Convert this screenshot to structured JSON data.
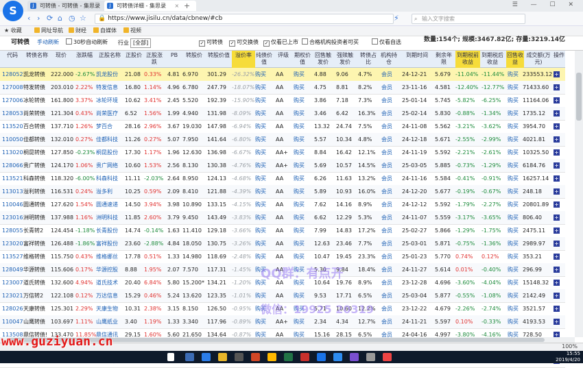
{
  "browser": {
    "tabs": [
      {
        "label": "可转债 - 可转债 - 集思录"
      },
      {
        "label": "可转债详细 - 集思录"
      }
    ],
    "url": "https://www.jisilu.cn/data/cbnew/#cb",
    "search_placeholder": "输入文字搜索",
    "bookmarks": [
      "收藏",
      "网址导航",
      "财经",
      "自媒体",
      "视频"
    ],
    "zoom": "100%"
  },
  "filters": {
    "title": "可转债",
    "manual_refresh": "手动刷新",
    "auto_refresh": "30秒自动刷新",
    "industry_label": "行业",
    "industry_value": "[全部]",
    "check_cb": "可转债",
    "check_exchangeable": "可交换债",
    "check_listed": "仅看已上市",
    "check_qualified": "合格机构投资者可买",
    "check_self": "仅看自选",
    "stats": "数量:154个; 规模:3467.82亿; 存量:3219.14亿"
  },
  "table": {
    "headers": [
      "代码",
      "转债名称",
      "现价",
      "涨跌幅",
      "正股名称",
      "正股价",
      "正股涨跌",
      "PB",
      "转股价",
      "转股价值",
      "溢价率",
      "纯债价值",
      "评级",
      "期权价值",
      "回售触发价",
      "强赎触发价",
      "转债占比",
      "机构持仓",
      "到期时间",
      "剩余年限",
      "到期税前收益",
      "到期税后收益",
      "回售收益",
      "成交额(万元)",
      "操作"
    ],
    "rows": [
      {
        "code": "128052",
        "name": "凯龙转债",
        "price": "222.000",
        "chg": "-2.67%",
        "stock": "凯龙股份",
        "sprice": "21.08",
        "schg": "0.33%",
        "pb": "4.81",
        "cvt": "6.970",
        "cval": "301.29",
        "prem": "-26.32%",
        "bond": "购买",
        "rating": "AA",
        "opt": "购买",
        "put": "4.88",
        "call": "9.06",
        "ratio": "4.7%",
        "inst": "会员",
        "due": "24-12-21",
        "years": "5.679",
        "ytm": "-11.04%",
        "ytm2": "-11.44%",
        "putret": "购买",
        "vol": "233553.12"
      },
      {
        "code": "127008",
        "name": "特发转债",
        "price": "203.010",
        "chg": "2.22%",
        "stock": "特发信息",
        "sprice": "16.80",
        "schg": "1.14%",
        "pb": "4.96",
        "cvt": "6.780",
        "cval": "247.79",
        "prem": "-18.07%",
        "bond": "购买",
        "rating": "AA",
        "opt": "购买",
        "put": "4.75",
        "call": "8.81",
        "ratio": "8.2%",
        "inst": "会员",
        "due": "23-11-16",
        "years": "4.581",
        "ytm": "-12.40%",
        "ytm2": "-12.77%",
        "putret": "购买",
        "vol": "71433.60"
      },
      {
        "code": "127006",
        "name": "冰轮转债",
        "price": "161.800",
        "chg": "3.37%",
        "stock": "冰轮环境",
        "sprice": "10.62",
        "schg": "3.41%",
        "pb": "2.45",
        "cvt": "5.520",
        "cval": "192.39",
        "prem": "-15.90%",
        "bond": "购买",
        "rating": "AA",
        "opt": "购买",
        "put": "3.86",
        "call": "7.18",
        "ratio": "7.3%",
        "inst": "会员",
        "due": "25-01-14",
        "years": "5.745",
        "ytm": "-5.82%",
        "ytm2": "-6.25%",
        "putret": "购买",
        "vol": "11164.06"
      },
      {
        "code": "128053",
        "name": "尚荣转债",
        "price": "121.304",
        "chg": "0.43%",
        "stock": "尚荣医疗",
        "sprice": "6.52",
        "schg": "1.56%",
        "pb": "1.99",
        "cvt": "4.940",
        "cval": "131.98",
        "prem": "-8.09%",
        "bond": "购买",
        "rating": "AA",
        "opt": "购买",
        "put": "3.46",
        "call": "6.42",
        "ratio": "16.3%",
        "inst": "会员",
        "due": "25-02-14",
        "years": "5.830",
        "ytm": "-0.88%",
        "ytm2": "-1.34%",
        "putret": "购买",
        "vol": "1735.12"
      },
      {
        "code": "113520",
        "name": "百合转债",
        "price": "137.710",
        "chg": "1.26%",
        "stock": "梦百合",
        "sprice": "28.16",
        "schg": "2.96%",
        "pb": "3.67",
        "cvt": "19.030",
        "cval": "147.98",
        "prem": "-6.94%",
        "bond": "购买",
        "rating": "AA",
        "opt": "购买",
        "put": "13.32",
        "call": "24.74",
        "ratio": "7.5%",
        "inst": "会员",
        "due": "24-11-08",
        "years": "5.562",
        "ytm": "-3.21%",
        "ytm2": "-3.62%",
        "putret": "购买",
        "vol": "3954.70"
      },
      {
        "code": "110050",
        "name": "佳都转债",
        "price": "132.010",
        "chg": "0.27%",
        "stock": "佳都科技",
        "sprice": "11.26",
        "schg": "0.27%",
        "pb": "5.07",
        "cvt": "7.950",
        "cval": "141.64",
        "prem": "-6.80%",
        "bond": "购买",
        "rating": "AA",
        "opt": "购买",
        "put": "5.57",
        "call": "10.34",
        "ratio": "4.8%",
        "inst": "会员",
        "due": "24-12-18",
        "years": "5.671",
        "ytm": "-2.55%",
        "ytm2": "-2.99%",
        "putret": "购买",
        "vol": "4021.81"
      },
      {
        "code": "113020",
        "name": "桐昆转债",
        "price": "127.850",
        "chg": "-0.23%",
        "stock": "桐昆股份",
        "sprice": "17.30",
        "schg": "1.17%",
        "pb": "1.96",
        "cvt": "12.630",
        "cval": "136.98",
        "prem": "-6.67%",
        "bond": "购买",
        "rating": "AA+",
        "opt": "购买",
        "put": "8.84",
        "call": "16.42",
        "ratio": "12.1%",
        "inst": "会员",
        "due": "24-11-19",
        "years": "5.592",
        "ytm": "-2.21%",
        "ytm2": "-2.61%",
        "putret": "购买",
        "vol": "10325.50"
      },
      {
        "code": "128066",
        "name": "贵广转债",
        "price": "124.170",
        "chg": "1.06%",
        "stock": "贵广网络",
        "sprice": "10.60",
        "schg": "1.53%",
        "pb": "2.56",
        "cvt": "8.130",
        "cval": "130.38",
        "prem": "-4.76%",
        "bond": "购买",
        "rating": "AA+",
        "opt": "购买",
        "put": "5.69",
        "call": "10.57",
        "ratio": "14.5%",
        "inst": "会员",
        "due": "25-03-05",
        "years": "5.885",
        "ytm": "-0.73%",
        "ytm2": "-1.29%",
        "putret": "购买",
        "vol": "6184.76"
      },
      {
        "code": "113521",
        "name": "科森转债",
        "price": "118.320",
        "chg": "-6.00%",
        "stock": "科森科技",
        "sprice": "11.11",
        "schg": "-2.03%",
        "pb": "2.64",
        "cvt": "8.950",
        "cval": "124.13",
        "prem": "-4.68%",
        "bond": "购买",
        "rating": "AA",
        "opt": "购买",
        "put": "6.26",
        "call": "11.63",
        "ratio": "13.2%",
        "inst": "会员",
        "due": "24-11-16",
        "years": "5.584",
        "ytm": "-0.41%",
        "ytm2": "-0.91%",
        "putret": "购买",
        "vol": "16257.14"
      },
      {
        "code": "113013",
        "name": "溢利转债",
        "price": "116.531",
        "chg": "0.24%",
        "stock": "溢多利",
        "sprice": "10.25",
        "schg": "0.59%",
        "pb": "2.09",
        "cvt": "8.410",
        "cval": "121.88",
        "prem": "-4.39%",
        "bond": "购买",
        "rating": "AA",
        "opt": "购买",
        "put": "5.89",
        "call": "10.93",
        "ratio": "16.0%",
        "inst": "会员",
        "due": "24-12-20",
        "years": "5.677",
        "ytm": "-0.19%",
        "ytm2": "-0.67%",
        "putret": "购买",
        "vol": "248.18"
      },
      {
        "code": "110046",
        "name": "圆通转债",
        "price": "127.620",
        "chg": "1.54%",
        "stock": "圆通速递",
        "sprice": "14.50",
        "schg": "3.94%",
        "pb": "3.98",
        "cvt": "10.890",
        "cval": "133.15",
        "prem": "-4.15%",
        "bond": "购买",
        "rating": "AA",
        "opt": "购买",
        "put": "7.62",
        "call": "14.16",
        "ratio": "8.9%",
        "inst": "会员",
        "due": "24-12-12",
        "years": "5.592",
        "ytm": "-1.79%",
        "ytm2": "-2.27%",
        "putret": "购买",
        "vol": "20801.89"
      },
      {
        "code": "123016",
        "name": "洲明转债",
        "price": "137.988",
        "chg": "1.16%",
        "stock": "洲明科技",
        "sprice": "11.85",
        "schg": "2.60%",
        "pb": "3.79",
        "cvt": "9.450",
        "cval": "143.49",
        "prem": "-3.83%",
        "bond": "购买",
        "rating": "AA",
        "opt": "购买",
        "put": "6.62",
        "call": "12.29",
        "ratio": "5.3%",
        "inst": "会员",
        "due": "24-11-07",
        "years": "5.559",
        "ytm": "-3.17%",
        "ytm2": "-3.65%",
        "putret": "购买",
        "vol": "806.40"
      },
      {
        "code": "128055",
        "name": "长青转2",
        "price": "124.454",
        "chg": "-1.18%",
        "stock": "长青股份",
        "sprice": "14.74",
        "schg": "-0.14%",
        "pb": "1.63",
        "cvt": "11.410",
        "cval": "129.18",
        "prem": "-3.66%",
        "bond": "购买",
        "rating": "AA",
        "opt": "购买",
        "put": "7.99",
        "call": "14.83",
        "ratio": "17.2%",
        "inst": "会员",
        "due": "25-02-27",
        "years": "5.866",
        "ytm": "-1.29%",
        "ytm2": "-1.75%",
        "putret": "购买",
        "vol": "2475.11"
      },
      {
        "code": "123020",
        "name": "富祥转债",
        "price": "126.488",
        "chg": "-1.86%",
        "stock": "富祥股份",
        "sprice": "23.60",
        "schg": "-2.88%",
        "pb": "4.84",
        "cvt": "18.050",
        "cval": "130.75",
        "prem": "-3.26%",
        "bond": "购买",
        "rating": "AA",
        "opt": "购买",
        "put": "12.63",
        "call": "23.46",
        "ratio": "7.7%",
        "inst": "会员",
        "due": "25-03-01",
        "years": "5.871",
        "ytm": "-0.75%",
        "ytm2": "-1.36%",
        "putret": "购买",
        "vol": "2989.97"
      },
      {
        "code": "113527",
        "name": "维格转债",
        "price": "115.750",
        "chg": "0.43%",
        "stock": "维格娜丝",
        "sprice": "17.78",
        "schg": "0.51%",
        "pb": "1.33",
        "cvt": "14.980",
        "cval": "118.69",
        "prem": "-2.48%",
        "bond": "购买",
        "rating": "AA",
        "opt": "购买",
        "put": "10.47",
        "call": "19.45",
        "ratio": "23.3%",
        "inst": "会员",
        "due": "25-01-23",
        "years": "5.770",
        "ytm": "0.74%",
        "ytm2": "0.12%",
        "putret": "购买",
        "vol": "353.21"
      },
      {
        "code": "128049",
        "name": "华源转债",
        "price": "115.606",
        "chg": "0.17%",
        "stock": "华源控股",
        "sprice": "8.88",
        "schg": "1.95%",
        "pb": "2.07",
        "cvt": "7.570",
        "cval": "117.31",
        "prem": "-1.45%",
        "bond": "购买",
        "rating": "AA",
        "opt": "购买",
        "put": "5.30",
        "call": "9.84",
        "ratio": "18.4%",
        "inst": "会员",
        "due": "24-11-27",
        "years": "5.614",
        "ytm": "0.01%",
        "ytm2": "-0.40%",
        "putret": "购买",
        "vol": "296.99"
      },
      {
        "code": "123007",
        "name": "道氏转债",
        "price": "132.600",
        "chg": "4.94%",
        "stock": "道氏技术",
        "sprice": "20.40",
        "schg": "6.84%",
        "pb": "5.80",
        "cvt": "15.200*",
        "cval": "134.21",
        "prem": "-1.20%",
        "bond": "购买",
        "rating": "AA",
        "opt": "购买",
        "put": "10.64",
        "call": "19.76",
        "ratio": "8.9%",
        "inst": "会员",
        "due": "23-12-28",
        "years": "4.696",
        "ytm": "-3.60%",
        "ytm2": "-4.04%",
        "putret": "购买",
        "vol": "15148.32"
      },
      {
        "code": "123021",
        "name": "万信转2",
        "price": "122.108",
        "chg": "0.12%",
        "stock": "万达信息",
        "sprice": "15.29",
        "schg": "0.46%",
        "pb": "5.24",
        "cvt": "13.620",
        "cval": "123.35",
        "prem": "-1.01%",
        "bond": "购买",
        "rating": "AA",
        "opt": "购买",
        "put": "9.53",
        "call": "17.71",
        "ratio": "6.5%",
        "inst": "会员",
        "due": "25-03-04",
        "years": "5.877",
        "ytm": "-0.55%",
        "ytm2": "-1.08%",
        "putret": "购买",
        "vol": "2142.49"
      },
      {
        "code": "128026",
        "name": "天康转债",
        "price": "125.301",
        "chg": "2.29%",
        "stock": "天康生物",
        "sprice": "10.31",
        "schg": "2.38%",
        "pb": "3.15",
        "cvt": "8.150",
        "cval": "126.50",
        "prem": "-0.95%",
        "bond": "购买",
        "rating": "AA",
        "opt": "购买",
        "put": "5.71",
        "call": "10.60",
        "ratio": "12.2%",
        "inst": "会员",
        "due": "23-12-22",
        "years": "4.679",
        "ytm": "-2.26%",
        "ytm2": "-2.74%",
        "putret": "购买",
        "vol": "3521.57"
      },
      {
        "code": "110047",
        "name": "山鹰转债",
        "price": "103.697",
        "chg": "1.11%",
        "stock": "山鹰纸业",
        "sprice": "3.40",
        "schg": "1.19%",
        "pb": "1.33",
        "cvt": "3.340",
        "cval": "117.96",
        "prem": "-0.89%",
        "bond": "购买",
        "rating": "AA+",
        "opt": "购买",
        "put": "2.34",
        "call": "4.34",
        "ratio": "12.7%",
        "inst": "会员",
        "due": "24-11-21",
        "years": "5.597",
        "ytm": "0.10%",
        "ytm2": "-0.33%",
        "putret": "购买",
        "vol": "4193.53"
      },
      {
        "code": "113508",
        "name": "鼎信转债!",
        "price": "133.470",
        "chg": "11.85%",
        "stock": "鼎信通讯",
        "sprice": "29.15",
        "schg": "1.60%",
        "pb": "5.60",
        "cvt": "21.650",
        "cval": "134.64",
        "prem": "-0.87%",
        "bond": "购买",
        "rating": "AA",
        "opt": "购买",
        "put": "15.16",
        "call": "28.15",
        "ratio": "6.5%",
        "inst": "会员",
        "due": "24-04-16",
        "years": "4.997",
        "ytm": "-3.80%",
        "ytm2": "-4.16%",
        "putret": "购买",
        "vol": "728.50"
      },
      {
        "code": "128036",
        "name": "金农转债",
        "price": "124.480",
        "chg": "0.81%",
        "stock": "金新农",
        "sprice": "6.76",
        "schg": "1.05%",
        "pb": "2.49",
        "cvt": "5.410",
        "cval": "124.95",
        "prem": "-0.72%",
        "bond": "购买",
        "rating": "AA",
        "opt": "购买",
        "put": "3.79",
        "call": "7.03",
        "ratio": "15.5%",
        "inst": "会员",
        "due": "24-03-09",
        "years": "4.885",
        "ytm": "-5.85%",
        "ytm2": "-6.22%",
        "putret": "购买",
        "vol": "12083.22"
      },
      {
        "code": "123008",
        "name": "康泰转债!",
        "price": "167.000",
        "chg": "-0.95%",
        "stock": "康泰生物",
        "sprice": "56.60",
        "schg": "0.46%",
        "pb": "20.54",
        "cvt": "31.230",
        "cval": "168.20",
        "prem": "-0.71%",
        "bond": "购买",
        "rating": "AA",
        "opt": "购买",
        "put": "21.86",
        "call": "40.60",
        "ratio": "2.4%",
        "inst": "会员",
        "due": "24-02-01",
        "years": "4.782",
        "ytm": "-8.32%",
        "ytm2": "-8.69%",
        "putret": "购买",
        "vol": "1360.22"
      }
    ]
  },
  "watermarks": {
    "site": "www.guziyuan.cn",
    "overlay1": "QQ群：有点开",
    "overlay2": "微信：19925 20319"
  },
  "taskbar": {
    "time": "15:55",
    "date": "2019/4/20"
  },
  "colors": {
    "highlight_row": "#fdf5b0",
    "up": "#e0312f",
    "down": "#1b8a3a",
    "link": "#1b5fb4",
    "header_bg": "#e6eef8"
  }
}
